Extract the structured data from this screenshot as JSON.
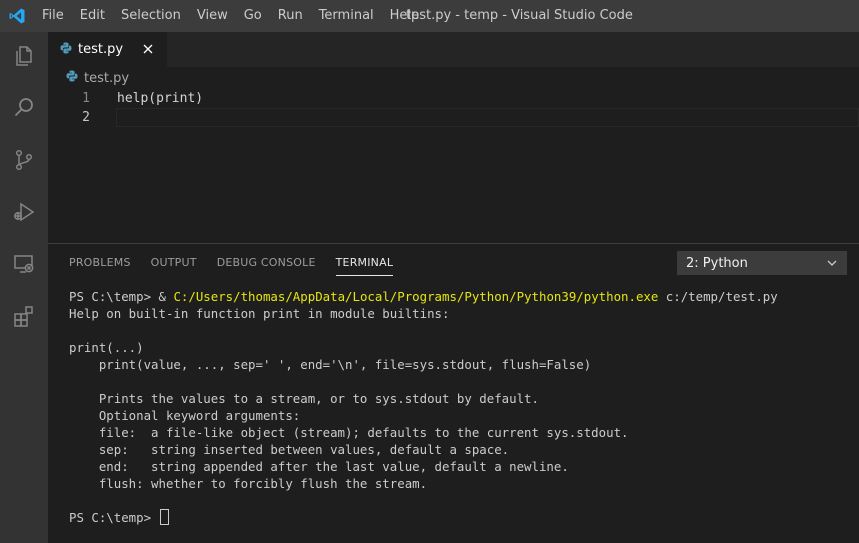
{
  "window": {
    "title": "test.py - temp - Visual Studio Code"
  },
  "colors": {
    "accent": "#007acc",
    "python_icon": "#519aba",
    "terminal_path": "#e5e510"
  },
  "menu": {
    "items": [
      "File",
      "Edit",
      "Selection",
      "View",
      "Go",
      "Run",
      "Terminal",
      "Help"
    ]
  },
  "activity_bar": {
    "icons": [
      "explorer-icon",
      "search-icon",
      "source-control-icon",
      "run-debug-icon",
      "remote-explorer-icon",
      "extensions-icon"
    ]
  },
  "editor": {
    "tab": {
      "label": "test.py",
      "icon": "python-file-icon"
    },
    "breadcrumb": {
      "label": "test.py"
    },
    "lines": [
      {
        "number": "1",
        "text": "help(print)"
      },
      {
        "number": "2",
        "text": ""
      }
    ]
  },
  "panel": {
    "tabs": [
      "PROBLEMS",
      "OUTPUT",
      "DEBUG CONSOLE",
      "TERMINAL"
    ],
    "active_tab": "TERMINAL",
    "terminal_select": {
      "value": "2: Python"
    },
    "terminal": {
      "prompt": "PS C:\\temp> ",
      "command_prefix": "& ",
      "command_exe": "C:/Users/thomas/AppData/Local/Programs/Python/Python39/python.exe",
      "command_arg": " c:/temp/test.py",
      "output_lines": [
        "Help on built-in function print in module builtins:",
        "",
        "print(...)",
        "    print(value, ..., sep=' ', end='\\n', file=sys.stdout, flush=False)",
        "",
        "    Prints the values to a stream, or to sys.stdout by default.",
        "    Optional keyword arguments:",
        "    file:  a file-like object (stream); defaults to the current sys.stdout.",
        "    sep:   string inserted between values, default a space.",
        "    end:   string appended after the last value, default a newline.",
        "    flush: whether to forcibly flush the stream.",
        ""
      ],
      "final_prompt": "PS C:\\temp> "
    }
  }
}
